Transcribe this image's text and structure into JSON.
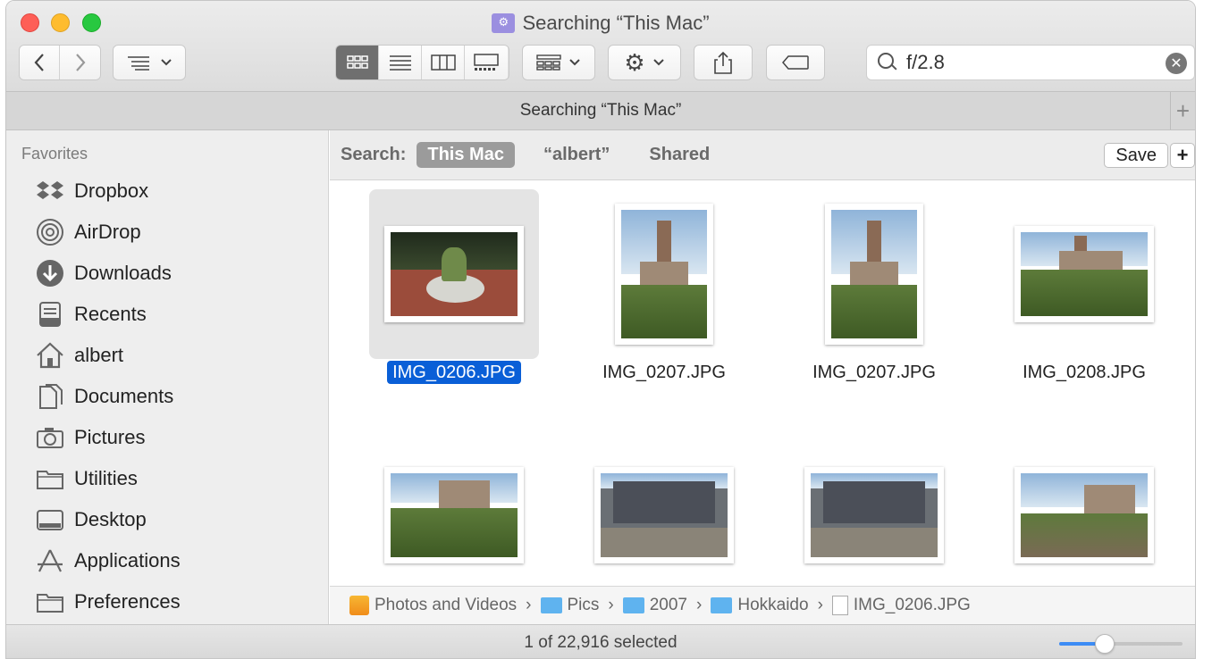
{
  "window": {
    "title": "Searching “This Mac”"
  },
  "toolbar": {
    "back_icon": "chevron-left-icon",
    "forward_icon": "chevron-right-icon",
    "view_options": [
      "icon-view",
      "list-view",
      "column-view",
      "gallery-view"
    ],
    "active_view": "icon-view",
    "search_value": "f/2.8"
  },
  "tabbar": {
    "label": "Searching “This Mac”"
  },
  "sidebar": {
    "heading": "Favorites",
    "items": [
      {
        "label": "Dropbox",
        "icon": "dropbox-icon"
      },
      {
        "label": "AirDrop",
        "icon": "airdrop-icon"
      },
      {
        "label": "Downloads",
        "icon": "downloads-icon"
      },
      {
        "label": "Recents",
        "icon": "recents-icon"
      },
      {
        "label": "albert",
        "icon": "home-icon"
      },
      {
        "label": "Documents",
        "icon": "documents-icon"
      },
      {
        "label": "Pictures",
        "icon": "camera-icon"
      },
      {
        "label": "Utilities",
        "icon": "folder-icon"
      },
      {
        "label": "Desktop",
        "icon": "desktop-icon"
      },
      {
        "label": "Applications",
        "icon": "applications-icon"
      },
      {
        "label": "Preferences",
        "icon": "folder-icon"
      }
    ]
  },
  "scope": {
    "label": "Search:",
    "options": [
      "This Mac",
      "“albert”",
      "Shared"
    ],
    "active": "This Mac",
    "save_label": "Save",
    "add_label": "+"
  },
  "files": [
    {
      "name": "IMG_0206.JPG",
      "selected": true
    },
    {
      "name": "IMG_0207.JPG",
      "selected": false
    },
    {
      "name": "IMG_0207.JPG",
      "selected": false
    },
    {
      "name": "IMG_0208.JPG",
      "selected": false
    },
    {
      "name": "",
      "selected": false
    },
    {
      "name": "",
      "selected": false
    },
    {
      "name": "",
      "selected": false
    },
    {
      "name": "",
      "selected": false
    }
  ],
  "pathbar": {
    "items": [
      "Photos and Videos",
      "Pics",
      "2007",
      "Hokkaido",
      "IMG_0206.JPG"
    ],
    "separator": "›"
  },
  "status": {
    "text": "1 of 22,916 selected",
    "icon_size_slider": 0.37
  },
  "colors": {
    "selection": "#0a5fd7",
    "folder": "#5fb3ef",
    "close": "#fe5f57",
    "minimize": "#febc2e",
    "maximize": "#28c840"
  }
}
